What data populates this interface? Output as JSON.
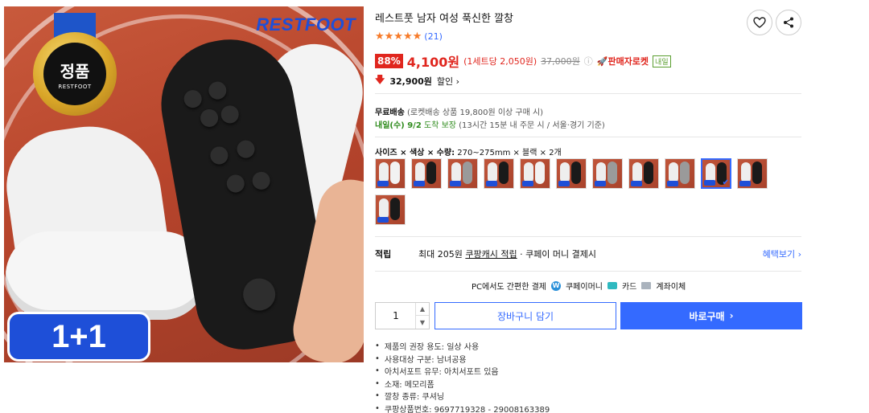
{
  "hero": {
    "brand": "RESTFOOT",
    "medal_title": "정품",
    "medal_sub": "RESTFOOT",
    "promo": "1+1"
  },
  "product": {
    "title": "레스트풋 남자 여성 푹신한 깔창",
    "stars": "★★★★★",
    "review_count": "(21)"
  },
  "actions": {
    "wishlist_icon": "heart-icon",
    "share_icon": "share-icon"
  },
  "price": {
    "discount_rate": "88%",
    "sale_price": "4,100원",
    "unit_price": "(1세트당 2,050원)",
    "original_price": "37,000원",
    "seller_rocket": "🚀판매자로켓",
    "tomorrow_badge": "내일",
    "coupon_amount": "32,900원",
    "coupon_label": "할인 ›",
    "accent_color": "#e0261e"
  },
  "shipping": {
    "free_label": "무료배송",
    "free_detail": "(로켓배송 상품 19,800원 이상 구매 시)",
    "arrival": "내일(수) 9/2",
    "arrival_guarantee": "도착 보장",
    "arrival_detail": "(13시간 15분 내 주문 시 / 서울·경기 기준)"
  },
  "options": {
    "label_prefix": "사이즈 × 색상 × 수량:",
    "label_value": "270~275mm × 블랙 × 2개",
    "thumbnails": [
      {
        "variant": "white"
      },
      {
        "variant": "black"
      },
      {
        "variant": "gray"
      },
      {
        "variant": "black"
      },
      {
        "variant": "white"
      },
      {
        "variant": "black"
      },
      {
        "variant": "gray"
      },
      {
        "variant": "black"
      },
      {
        "variant": "gray"
      },
      {
        "variant": "black",
        "selected": true
      },
      {
        "variant": "black"
      },
      {
        "variant": "black"
      }
    ]
  },
  "reward": {
    "label": "적립",
    "prefix": "최대 205원",
    "link": "쿠팡캐시 적립",
    "suffix": "· 쿠페이 머니 결제시",
    "benefits_link": "혜택보기 ›"
  },
  "payment": {
    "headline": "PC에서도 간편한 결제",
    "coupay": "쿠페이머니",
    "card": "카드",
    "bank": "계좌이체"
  },
  "purchase": {
    "quantity": "1",
    "cart_label": "장바구니 담기",
    "buy_label": "바로구매",
    "buy_arrow": "›",
    "brand_color": "#346aff"
  },
  "specs": [
    "제품의 권장 용도: 일상 사용",
    "사용대상 구분: 남녀공용",
    "아치서포트 유무: 아치서포트 있음",
    "소재: 메모리폼",
    "깔창 종류: 쿠셔닝",
    "쿠팡상품번호: 9697719328 - 29008163389"
  ]
}
